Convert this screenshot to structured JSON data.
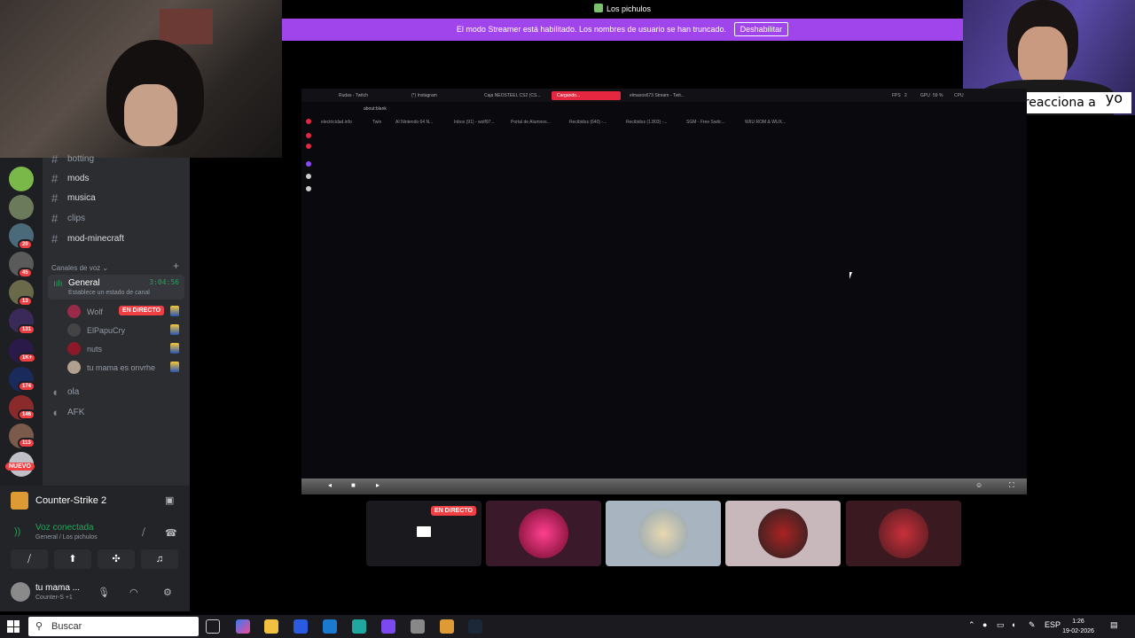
{
  "title": {
    "app_name": "Los pichulos"
  },
  "streamer_banner": {
    "message": "El modo Streamer está habilitado. Los nombres de usuario se han truncado.",
    "button": "Deshabilitar"
  },
  "caption": {
    "text": "Pancho reacciona a",
    "yo": "yo"
  },
  "servers": {
    "badges": [
      "20",
      "45",
      "13",
      "131",
      "1K+",
      "174",
      "146",
      "113"
    ],
    "new_label": "NUEVO"
  },
  "channels": {
    "text": [
      "botting",
      "mods",
      "musica",
      "clips",
      "mod-minecraft"
    ],
    "voice_category": "Canales de voz",
    "general": {
      "name": "General",
      "time": "3:04:56",
      "status": "Establece un estado de canal"
    },
    "members": [
      {
        "name": "Wolf",
        "live": "EN DIRECTO",
        "color": "#9a2a4a"
      },
      {
        "name": "ElPapuCry",
        "color": "#444"
      },
      {
        "name": "nuts",
        "color": "#8a1a2a"
      },
      {
        "name": "tu mama es onvrhe",
        "color": "#b0a090"
      }
    ],
    "other_voice": [
      "ola",
      "AFK"
    ]
  },
  "user_panel": {
    "game": "Counter-Strike 2",
    "voice_status": "Voz conectada",
    "voice_location": "General / Los pichulos",
    "username": "tu mama ...",
    "activity": "Counter-S +1"
  },
  "browser": {
    "tabs": [
      "Rudas - Twitch",
      "(*) Instagram",
      "Caja NEOSTEEL CS2 (CS...",
      "Cargando...",
      "elmaxos673 Stream - Twit..."
    ],
    "address": "about:blank",
    "bookmarks": [
      "electricidad.info",
      "Twin",
      "AI Nintendo 64 N...",
      "Inbox (91) - wolf97...",
      "Portal de Alumnos...",
      "Recibidos (640) -...",
      "Recibidos (1.803) -...",
      "SGM - Free Switc...",
      "WIIU ROM & WUX..."
    ],
    "fps_label": "FPS",
    "fps": "2",
    "gpu_label": "GPU",
    "gpu": "59 %",
    "cpu_label": "CPU"
  },
  "participants": {
    "live_label": "EN DIRECTO",
    "colors": [
      "#1a1a1e",
      "#3a1a2a",
      "#a8b4c0",
      "#c8b8bc",
      "#3a1a20"
    ]
  },
  "taskbar": {
    "search": "Buscar",
    "lang": "ESP",
    "time": "1:26",
    "date": "19-02-2026"
  },
  "colors": {
    "accent": "#a044ec",
    "live": "#f23f43",
    "online": "#23a559"
  }
}
